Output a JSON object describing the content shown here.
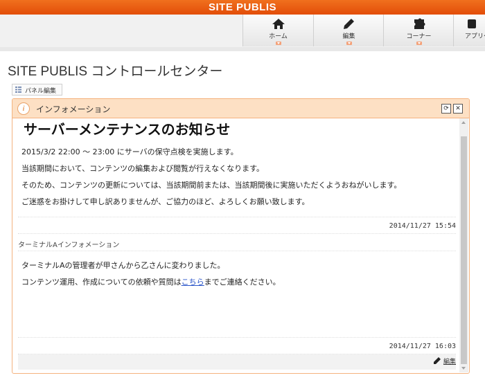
{
  "brand": "SITE PUBLIS",
  "nav": [
    {
      "label": "ホーム",
      "icon": "home-icon"
    },
    {
      "label": "編集",
      "icon": "pencil-icon"
    },
    {
      "label": "コーナー",
      "icon": "puzzle-icon"
    },
    {
      "label": "アプリケ",
      "icon": "app-icon"
    }
  ],
  "page_title": "SITE PUBLIS コントロールセンター",
  "panel_edit_label": "パネル編集",
  "panel": {
    "title": "インフォメーション",
    "refresh_icon": "refresh-icon",
    "close_icon": "close-icon",
    "notice": {
      "title": "サーバーメンテナンスのお知らせ",
      "lines": [
        "2015/3/2 22:00 〜 23:00 にサーバの保守点検を実施します。",
        "当該期間において、コンテンツの編集および閲覧が行えなくなります。",
        "そのため、コンテンツの更新については、当該期間前または、当該期間後に実施いただくようおねがいします。",
        "ご迷惑をお掛けして申し訳ありませんが、ご協力のほど、よろしくお願い致します。"
      ],
      "timestamp": "2014/11/27 15:54"
    },
    "terminal": {
      "title": "ターミナルAインフォメーション",
      "line1": "ターミナルAの管理者が甲さんから乙さんに変わりました。",
      "line2_before": "コンテンツ運用、作成についての依頼や質問は",
      "line2_link": "こちら",
      "line2_after": "までご連絡ください。",
      "timestamp": "2014/11/27 16:03"
    },
    "edit_label": "編集"
  },
  "colors": {
    "brand_orange": "#e8580f",
    "panel_header": "#fde0c4",
    "panel_border": "#f4b27e",
    "link": "#2a55c9"
  }
}
